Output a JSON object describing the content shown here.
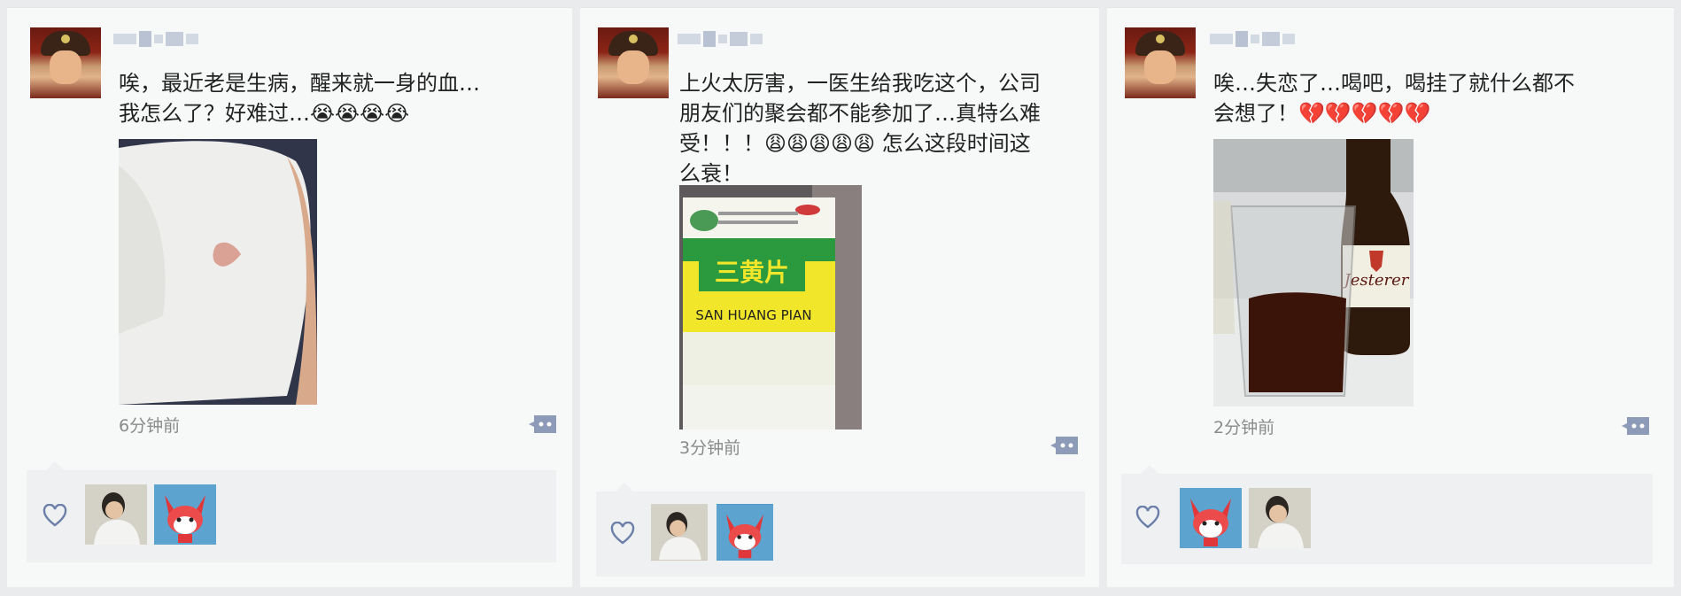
{
  "posts": [
    {
      "text_line1": "唉，最近老是生病，醒来就一身的血…",
      "text_line2": "我怎么了？好难过…😭😭😭😭",
      "time": "6分钟前",
      "image": "white-shirt-with-blood-stain",
      "likers": [
        "person-avatar",
        "fox-avatar"
      ]
    },
    {
      "text_line1": "上火太厉害，一医生给我吃这个，公司",
      "text_line2": "朋友们的聚会都不能参加了…真特么难",
      "text_line3": "受！！！😩😩😩😩😩 怎么这段时间这",
      "text_line4": "么衰！",
      "time": "3分钟前",
      "image": "medicine-box",
      "box_text": "三黄片",
      "box_pinyin": "SAN HUANG PIAN",
      "likers": [
        "person-avatar",
        "fox-avatar"
      ]
    },
    {
      "text_line1": "唉…失恋了…喝吧，喝挂了就什么都不",
      "text_line2": "会想了！💔💔💔💔💔",
      "time": "2分钟前",
      "image": "beer-bottle-and-glass",
      "bottle_label": "Jesterer",
      "likers": [
        "fox-avatar",
        "person-avatar"
      ]
    }
  ],
  "colors": {
    "accent_link": "#576b95",
    "like_bg": "#eef0f2",
    "panel_bg": "#f7f8f8"
  }
}
